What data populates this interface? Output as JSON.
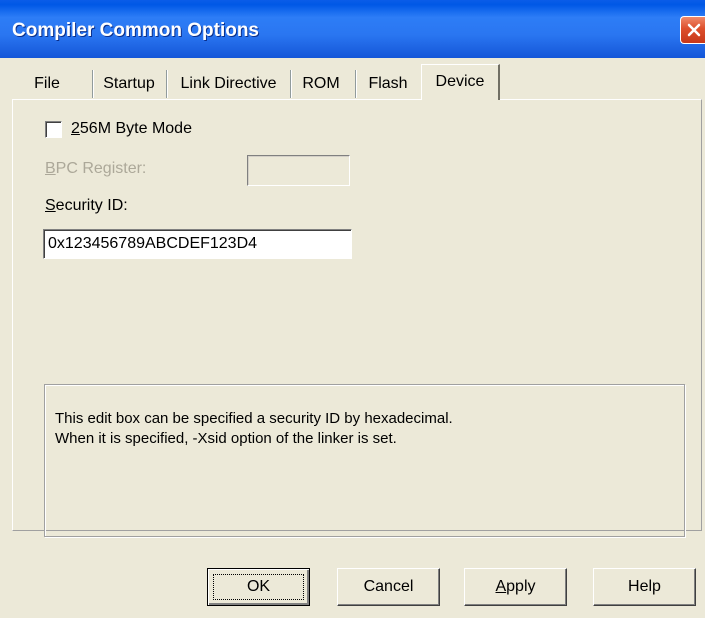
{
  "window": {
    "title": "Compiler Common Options"
  },
  "tabs": [
    {
      "label": "File"
    },
    {
      "label": "Startup"
    },
    {
      "label": "Link Directive"
    },
    {
      "label": "ROM"
    },
    {
      "label": "Flash"
    },
    {
      "label": "Device",
      "active": true
    }
  ],
  "device": {
    "byte_mode": {
      "label_first": "2",
      "label_rest": "56M Byte Mode",
      "checked": false
    },
    "bpc_register": {
      "label_first": "B",
      "label_rest": "PC Register:",
      "value": "",
      "enabled": false
    },
    "security_id": {
      "label_first": "S",
      "label_rest": "ecurity ID:",
      "value": "0x123456789ABCDEF123D4"
    },
    "description": {
      "line1": "This edit box can be specified a security ID by hexadecimal.",
      "line2": "When it is specified, -Xsid option of the linker is set."
    }
  },
  "buttons": {
    "ok": "OK",
    "cancel": "Cancel",
    "apply_first": "A",
    "apply_rest": "pply",
    "help": "Help"
  },
  "colors": {
    "titlebar": "#2a76f1",
    "dialog_bg": "#ece9d8",
    "close": "#dd4f2c",
    "disabled_text": "#aca899"
  }
}
